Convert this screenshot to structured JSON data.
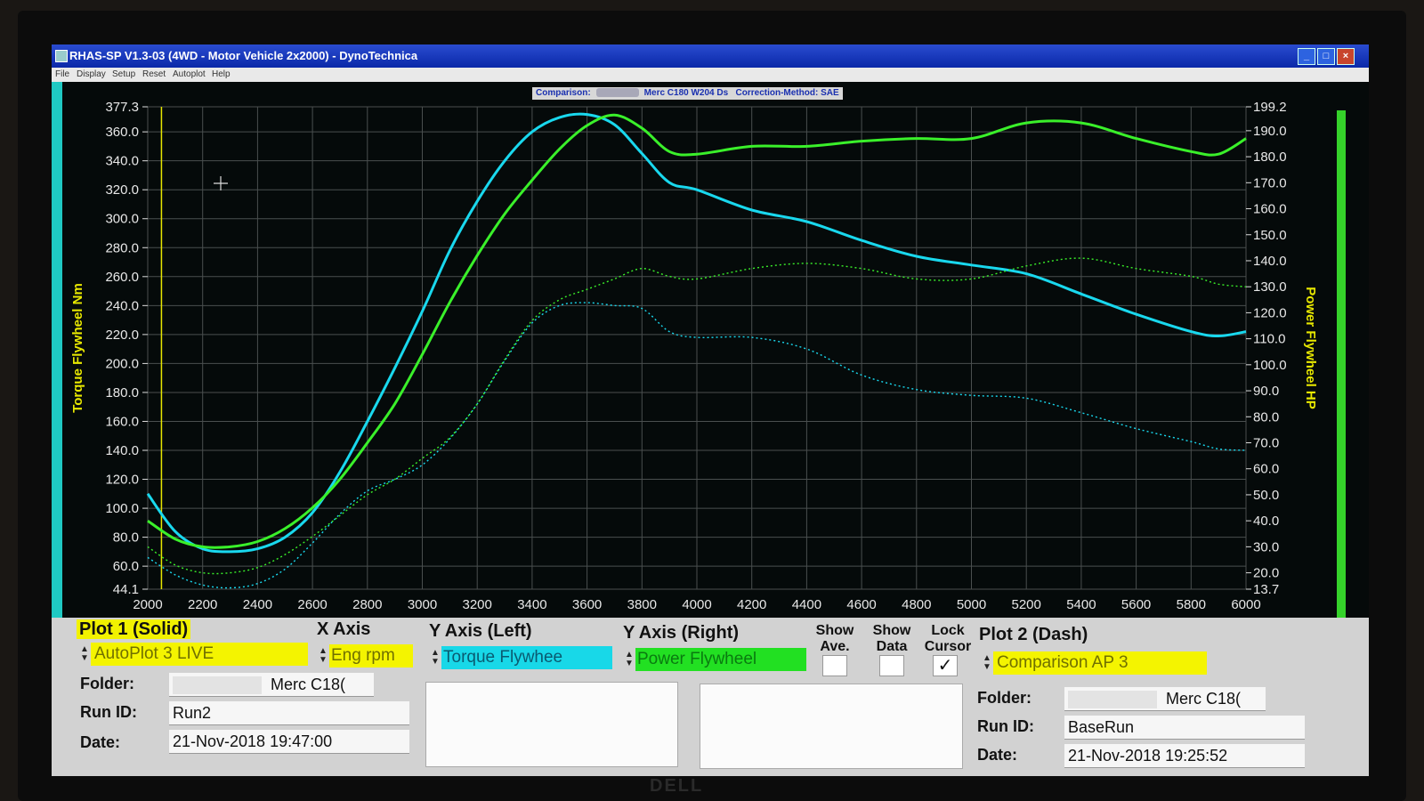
{
  "window": {
    "title": "RHAS-SP V1.3-03  (4WD - Motor Vehicle 2x2000) - DynoTechnica",
    "min_label": "_",
    "max_label": "□",
    "close_label": "×"
  },
  "menu": [
    "File",
    "Display",
    "Setup",
    "Reset",
    "Autoplot",
    "Help"
  ],
  "comparison_bar": {
    "prefix": "Comparison:",
    "vehicle": "Merc C180 W204 Ds",
    "correction": "Correction-Method: SAE"
  },
  "colors": {
    "torque_run": "#19d8ee",
    "power_run": "#3af02a",
    "left_axis_label": "#e8e800",
    "plot_bg": "#050a0a"
  },
  "chart_data": {
    "type": "line",
    "x_label": "",
    "y_left_label": "Torque Flywheel Nm",
    "y_right_label": "Power Flywheel HP",
    "xlim": [
      2000,
      6000
    ],
    "ylim_left": [
      44.1,
      377.3
    ],
    "ylim_right": [
      13.7,
      199.2
    ],
    "x_ticks": [
      "2000",
      "2200",
      "2400",
      "2600",
      "2800",
      "3000",
      "3200",
      "3400",
      "3600",
      "3800",
      "4000",
      "4200",
      "4400",
      "4600",
      "4800",
      "5000",
      "5200",
      "5400",
      "5600",
      "5800",
      "6000"
    ],
    "y_left_ticks": [
      "377.3",
      "360.0",
      "340.0",
      "320.0",
      "300.0",
      "280.0",
      "260.0",
      "240.0",
      "220.0",
      "200.0",
      "180.0",
      "160.0",
      "140.0",
      "120.0",
      "100.0",
      "80.0",
      "60.0",
      "44.1"
    ],
    "y_right_ticks": [
      "199.2",
      "190.0",
      "180.0",
      "170.0",
      "160.0",
      "150.0",
      "140.0",
      "130.0",
      "120.0",
      "110.0",
      "100.0",
      "90.0",
      "80.0",
      "70.0",
      "60.0",
      "50.0",
      "40.0",
      "30.0",
      "20.0",
      "13.7"
    ],
    "grid": true,
    "cursor_x": 2050,
    "series": [
      {
        "plot": "Plot 1 (Solid)",
        "axis": "left",
        "style": "solid",
        "color": "#19d8ee",
        "x": [
          2000,
          2100,
          2200,
          2300,
          2400,
          2500,
          2600,
          2700,
          2800,
          2900,
          3000,
          3100,
          3200,
          3300,
          3400,
          3500,
          3600,
          3700,
          3800,
          3900,
          4000,
          4200,
          4400,
          4600,
          4800,
          5000,
          5200,
          5400,
          5600,
          5800,
          5900,
          6000
        ],
        "y": [
          110,
          84,
          72,
          70,
          72,
          80,
          97,
          125,
          160,
          197,
          236,
          278,
          312,
          340,
          360,
          370,
          372,
          365,
          345,
          325,
          320,
          306,
          298,
          285,
          274,
          268,
          262,
          248,
          234,
          222,
          219,
          222
        ]
      },
      {
        "plot": "Plot 1 (Solid)",
        "axis": "right",
        "style": "solid",
        "color": "#3af02a",
        "x": [
          2000,
          2100,
          2200,
          2300,
          2400,
          2500,
          2600,
          2700,
          2800,
          2900,
          3000,
          3100,
          3200,
          3300,
          3400,
          3500,
          3600,
          3700,
          3800,
          3900,
          4000,
          4200,
          4400,
          4600,
          4800,
          5000,
          5200,
          5400,
          5600,
          5800,
          5900,
          6000
        ],
        "y": [
          40,
          33,
          30,
          30,
          32,
          37,
          45,
          56,
          70,
          85,
          104,
          124,
          142,
          158,
          171,
          183,
          192,
          196,
          191,
          182,
          181,
          184,
          184,
          186,
          187,
          187,
          193,
          193,
          187,
          182,
          181,
          187
        ]
      },
      {
        "plot": "Plot 2 (Dash)",
        "axis": "left",
        "style": "dash",
        "color": "#19d8ee",
        "x": [
          2000,
          2100,
          2200,
          2300,
          2400,
          2500,
          2600,
          2700,
          2800,
          2900,
          3000,
          3100,
          3200,
          3300,
          3400,
          3500,
          3600,
          3700,
          3800,
          3900,
          4000,
          4200,
          4400,
          4600,
          4800,
          5000,
          5200,
          5400,
          5600,
          5800,
          5900,
          6000
        ],
        "y": [
          66,
          54,
          47,
          45,
          48,
          58,
          76,
          96,
          112,
          120,
          130,
          148,
          172,
          202,
          228,
          240,
          242,
          240,
          238,
          222,
          218,
          218,
          210,
          192,
          182,
          178,
          176,
          166,
          155,
          146,
          141,
          140
        ]
      },
      {
        "plot": "Plot 2 (Dash)",
        "axis": "right",
        "style": "dash",
        "color": "#3af02a",
        "x": [
          2000,
          2100,
          2200,
          2300,
          2400,
          2500,
          2600,
          2700,
          2800,
          2900,
          3000,
          3100,
          3200,
          3300,
          3400,
          3500,
          3600,
          3700,
          3800,
          3900,
          4000,
          4200,
          4400,
          4600,
          4800,
          5000,
          5200,
          5400,
          5600,
          5800,
          5900,
          6000
        ],
        "y": [
          30,
          23,
          20,
          20,
          22,
          27,
          34,
          42,
          50,
          56,
          64,
          72,
          85,
          102,
          117,
          125,
          129,
          133,
          137,
          134,
          133,
          137,
          139,
          137,
          133,
          133,
          138,
          141,
          137,
          134,
          131,
          130
        ]
      }
    ]
  },
  "panel": {
    "plot1": {
      "header": "Plot 1 (Solid)",
      "source": "AutoPlot 3 LIVE",
      "folder_label": "Folder:",
      "folder_value": "Merc C18(",
      "runid_label": "Run ID:",
      "runid_value": "Run2",
      "date_label": "Date:",
      "date_value": "21-Nov-2018   19:47:00"
    },
    "x_axis": {
      "header": "X Axis",
      "value": "Eng rpm"
    },
    "y_left": {
      "header": "Y Axis (Left)",
      "value": "Torque Flywhee"
    },
    "y_right": {
      "header": "Y Axis (Right)",
      "value": "Power Flywheel"
    },
    "checks": {
      "show_ave_1": "Show",
      "show_ave_2": "Ave.",
      "show_data_1": "Show",
      "show_data_2": "Data",
      "lock_cursor_1": "Lock",
      "lock_cursor_2": "Cursor",
      "show_ave": false,
      "show_data": false,
      "lock_cursor": true,
      "check_mark": "✓"
    },
    "plot2": {
      "header": "Plot 2 (Dash)",
      "source": "Comparison AP 3",
      "folder_label": "Folder:",
      "folder_value": "Merc C18(",
      "runid_label": "Run ID:",
      "runid_value": "BaseRun",
      "date_label": "Date:",
      "date_value": "21-Nov-2018   19:25:52"
    }
  }
}
